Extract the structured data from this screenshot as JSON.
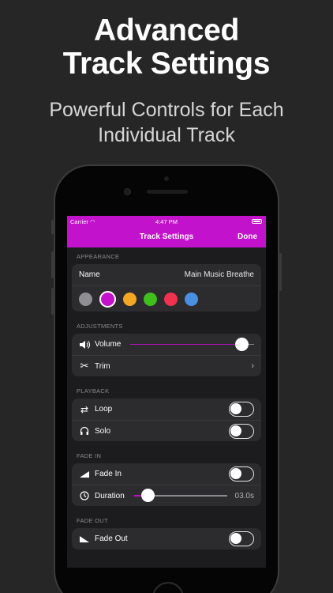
{
  "marketing": {
    "headline_line1": "Advanced",
    "headline_line2": "Track Settings",
    "subhead_line1": "Powerful Controls for Each",
    "subhead_line2": "Individual Track"
  },
  "status_bar": {
    "carrier": "Carrier",
    "time": "4:47 PM"
  },
  "nav": {
    "title": "Track Settings",
    "done_label": "Done",
    "accent_color": "#c312cc"
  },
  "appearance": {
    "header": "APPEARANCE",
    "name_label": "Name",
    "name_value": "Main Music Breathe",
    "colors": [
      "#8e8e93",
      "#c312cc",
      "#f5a623",
      "#3fbe1c",
      "#f2304f",
      "#4a90e2"
    ],
    "selected_color": "#c312cc"
  },
  "adjustments": {
    "header": "ADJUSTMENTS",
    "volume_label": "Volume",
    "volume_level": 0.9,
    "trim_label": "Trim"
  },
  "playback": {
    "header": "PLAYBACK",
    "loop_label": "Loop",
    "loop_on": false,
    "solo_label": "Solo",
    "solo_on": false
  },
  "fade_in": {
    "header": "FADE IN",
    "fade_in_label": "Fade In",
    "fade_in_on": false,
    "duration_label": "Duration",
    "duration_value": "03.0s",
    "duration_level": 0.15
  },
  "fade_out": {
    "header": "FADE OUT",
    "fade_out_label": "Fade Out",
    "fade_out_on": false
  }
}
